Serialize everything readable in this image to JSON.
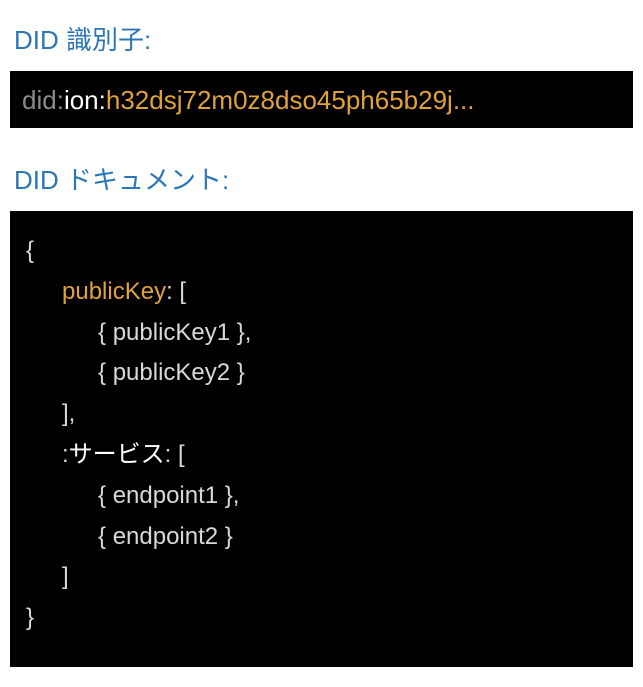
{
  "labels": {
    "identifier": "DID 識別子:",
    "document": "DID ドキュメント:"
  },
  "did": {
    "scheme": "did",
    "method": "ion",
    "value": "h32dsj72m0z8dso45ph65b29j..."
  },
  "doc": {
    "open": "{",
    "key_publicKey": "publicKey",
    "colon_open": ": [",
    "pk1_open": "{ ",
    "pk1_val": "publicKey1",
    "pk1_close": " },",
    "pk2_open": "{ ",
    "pk2_val": "publicKey2",
    "pk2_close": " }",
    "close_bracket_comma": "],",
    "key_service_prefix": ":",
    "key_service": "サービス",
    "key_service_colon_open": ": [",
    "ep1_open": "{ ",
    "ep1_val": "endpoint1",
    "ep1_close": " },",
    "ep2_open": "{ ",
    "ep2_val": "endpoint2",
    "ep2_close": " }",
    "close_bracket": "]",
    "close": "}"
  }
}
